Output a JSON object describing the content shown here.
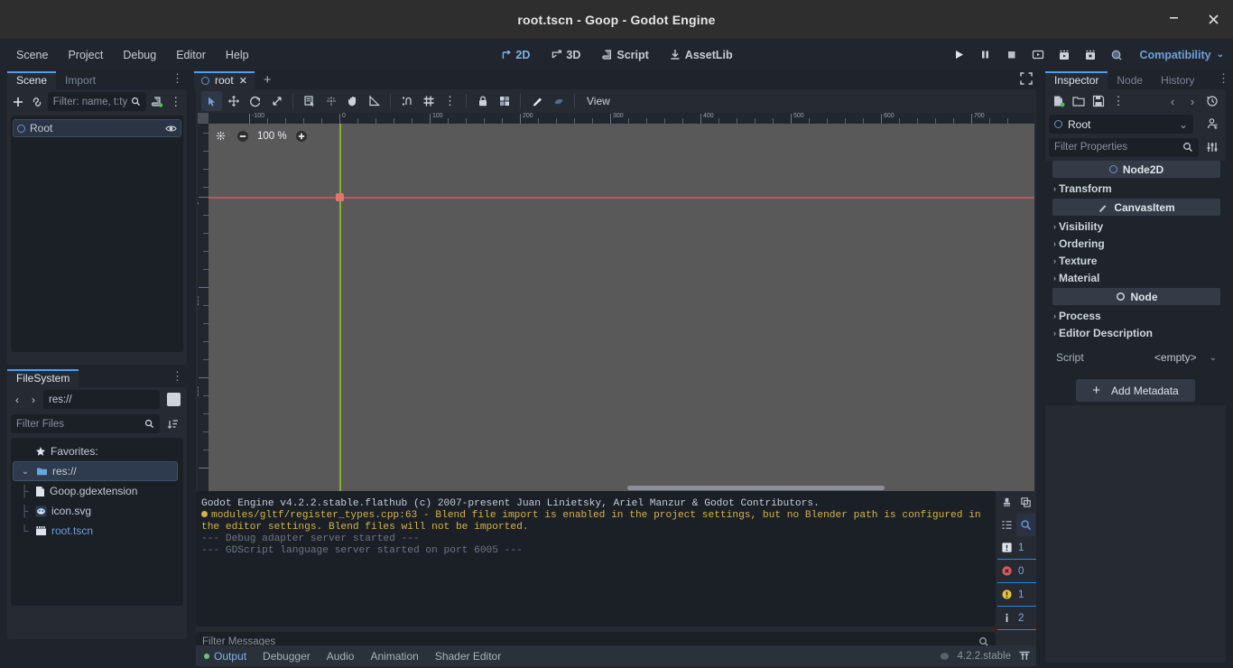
{
  "window": {
    "title": "root.tscn - Goop - Godot Engine",
    "minimize": "—",
    "close": "✕"
  },
  "menubar": {
    "items": [
      "Scene",
      "Project",
      "Debug",
      "Editor",
      "Help"
    ],
    "modes": [
      {
        "label": "2D",
        "icon": "2d-icon",
        "active": true
      },
      {
        "label": "3D",
        "icon": "3d-icon",
        "active": false
      },
      {
        "label": "Script",
        "icon": "script-icon",
        "active": false
      },
      {
        "label": "AssetLib",
        "icon": "assetlib-download-icon",
        "active": false
      }
    ],
    "play_buttons": [
      "play-icon",
      "pause-icon",
      "stop-icon",
      "play-scene-icon",
      "movie-start-icon",
      "movie-record-icon",
      "remote-debug-icon"
    ],
    "renderer": "Compatibility",
    "renderer_chevron": "⌄"
  },
  "scene_dock": {
    "tabs": [
      {
        "label": "Scene",
        "active": true
      },
      {
        "label": "Import",
        "active": false
      }
    ],
    "kebab": "⋮",
    "toolbar": {
      "add_icon": "plus-icon",
      "link_icon": "instance-child-scene-icon",
      "filter_placeholder": "Filter: name, t:ty",
      "search_icon": "search-icon",
      "script_icon": "create-script-icon",
      "kebab": "⋮"
    },
    "tree": [
      {
        "label": "Root",
        "icon": "node2d-icon",
        "selected": true,
        "visibility_icon": "eye-icon"
      }
    ]
  },
  "filesystem_dock": {
    "tabs": [
      {
        "label": "FileSystem",
        "active": true
      }
    ],
    "kebab": "⋮",
    "nav": {
      "back": "‹",
      "forward": "›",
      "path": "res://",
      "split_icon": "toggle-split-icon"
    },
    "filter": {
      "placeholder": "Filter Files",
      "search_icon": "search-icon",
      "sort_icon": "sort-icon"
    },
    "tree": [
      {
        "label": "Favorites:",
        "icon": "star-icon",
        "depth": 0,
        "type": "favorites"
      },
      {
        "label": "res://",
        "icon": "folder-icon",
        "depth": 0,
        "type": "folder",
        "selected": true,
        "expander": "⌄"
      },
      {
        "label": "Goop.gdextension",
        "icon": "file-icon",
        "depth": 1,
        "type": "file"
      },
      {
        "label": "icon.svg",
        "icon": "godot-svg-icon",
        "depth": 1,
        "type": "file"
      },
      {
        "label": "root.tscn",
        "icon": "packed-scene-icon",
        "depth": 1,
        "type": "scene",
        "highlight": true
      }
    ]
  },
  "viewport": {
    "tabs": [
      {
        "label": "root",
        "icon": "node2d-icon",
        "close": "✕",
        "active": true
      }
    ],
    "new_tab": "+",
    "expand_icon": "fullscreen-icon",
    "toolbar_tools": [
      {
        "name": "select-mode-icon",
        "active": true
      },
      {
        "name": "move-mode-icon",
        "active": false
      },
      {
        "name": "rotate-mode-icon",
        "active": false
      },
      {
        "name": "scale-mode-icon",
        "active": false
      },
      {
        "name": "list-select-icon",
        "active": false
      },
      {
        "name": "pivot-mode-icon",
        "active": false
      },
      {
        "name": "pan-mode-icon",
        "active": false
      },
      {
        "name": "ruler-mode-icon",
        "active": false
      },
      {
        "name": "snap-mode-icon",
        "active": false
      },
      {
        "name": "grid-snap-icon",
        "active": false
      },
      {
        "name": "snap-options-kebab-icon",
        "active": false
      },
      {
        "name": "lock-icon",
        "active": false
      },
      {
        "name": "group-icon",
        "active": false
      },
      {
        "name": "skeleton-options-icon",
        "active": false
      },
      {
        "name": "lock-selected-icon",
        "active": false
      }
    ],
    "view_menu": "View",
    "zoom": {
      "reset_icon": "zoom-reset-icon",
      "minus_icon": "zoom-out-icon",
      "value": "100 %",
      "plus_icon": "zoom-in-icon"
    },
    "ruler_h_labels": [
      "-100",
      "0",
      "100",
      "200",
      "300",
      "400",
      "500",
      "600",
      "700"
    ],
    "ruler_v_labels": [
      "0",
      "100",
      "200"
    ],
    "colors": {
      "background": "#595959",
      "x_axis": "#c7596a",
      "y_axis": "#8fc421",
      "origin": "#e2736f"
    }
  },
  "output": {
    "lines": [
      {
        "text": "Godot Engine v4.2.2.stable.flathub (c) 2007-present Juan Linietsky, Ariel Manzur & Godot Contributors.",
        "type": "info"
      },
      {
        "text": "modules/gltf/register_types.cpp:63 - Blend file import is enabled in the project settings, but no Blender path is configured in the editor settings. Blend files will not be imported.",
        "type": "warn"
      },
      {
        "text": "--- Debug adapter server started ---",
        "type": "dim"
      },
      {
        "text": "--- GDScript language server started on port 6005 ---",
        "type": "dim"
      }
    ],
    "side_buttons": [
      {
        "name": "clear-output-icon",
        "on": false
      },
      {
        "name": "copy-output-icon",
        "on": false
      },
      {
        "name": "collapse-output-icon",
        "on": false
      },
      {
        "name": "filter-search-icon",
        "on": true
      }
    ],
    "counters": [
      {
        "icon": "standard-message-icon",
        "value": "1"
      },
      {
        "icon": "error-icon",
        "value": "0"
      },
      {
        "icon": "warning-icon",
        "value": "1"
      },
      {
        "icon": "editor-message-icon",
        "value": "2"
      }
    ],
    "filter_placeholder": "Filter Messages",
    "filter_search_icon": "search-icon"
  },
  "bottom_tabs": {
    "tabs": [
      {
        "label": "Output",
        "active": true,
        "dot": true
      },
      {
        "label": "Debugger",
        "active": false
      },
      {
        "label": "Audio",
        "active": false
      },
      {
        "label": "Animation",
        "active": false
      },
      {
        "label": "Shader Editor",
        "active": false
      }
    ],
    "version": "4.2.2.stable",
    "version_icon": "godot-logo-icon",
    "expand_icon": "expand-bottom-panel-icon"
  },
  "inspector": {
    "tabs": [
      {
        "label": "Inspector",
        "active": true
      },
      {
        "label": "Node",
        "active": false
      },
      {
        "label": "History",
        "active": false
      }
    ],
    "kebab": "⋮",
    "toolbar": [
      {
        "name": "new-resource-icon"
      },
      {
        "name": "load-resource-icon"
      },
      {
        "name": "save-resource-icon"
      },
      {
        "name": "resource-kebab-icon"
      },
      {
        "name": "history-back-icon"
      },
      {
        "name": "history-forward-icon"
      },
      {
        "name": "reload-icon"
      }
    ],
    "object": {
      "label": "Root",
      "icon": "node2d-icon",
      "chevron": "⌄",
      "open_docs_icon": "open-docs-icon"
    },
    "filter": {
      "placeholder": "Filter Properties",
      "search_icon": "search-icon",
      "options_icon": "property-options-icon"
    },
    "groups": [
      {
        "type": "category",
        "label": "Node2D",
        "icon": "node2d-icon"
      },
      {
        "type": "property",
        "label": "Transform",
        "arrow": "›"
      },
      {
        "type": "category",
        "label": "CanvasItem",
        "icon": "canvasitem-icon"
      },
      {
        "type": "property",
        "label": "Visibility",
        "arrow": "›"
      },
      {
        "type": "property",
        "label": "Ordering",
        "arrow": "›"
      },
      {
        "type": "property",
        "label": "Texture",
        "arrow": "›"
      },
      {
        "type": "property",
        "label": "Material",
        "arrow": "›"
      },
      {
        "type": "category",
        "label": "Node",
        "icon": "node-icon"
      },
      {
        "type": "property",
        "label": "Process",
        "arrow": "›"
      },
      {
        "type": "property",
        "label": "Editor Description",
        "arrow": "›"
      }
    ],
    "script": {
      "label": "Script",
      "value": "<empty>",
      "chevron": "⌄"
    },
    "add_metadata": {
      "label": "Add Metadata",
      "plus": "+"
    }
  }
}
